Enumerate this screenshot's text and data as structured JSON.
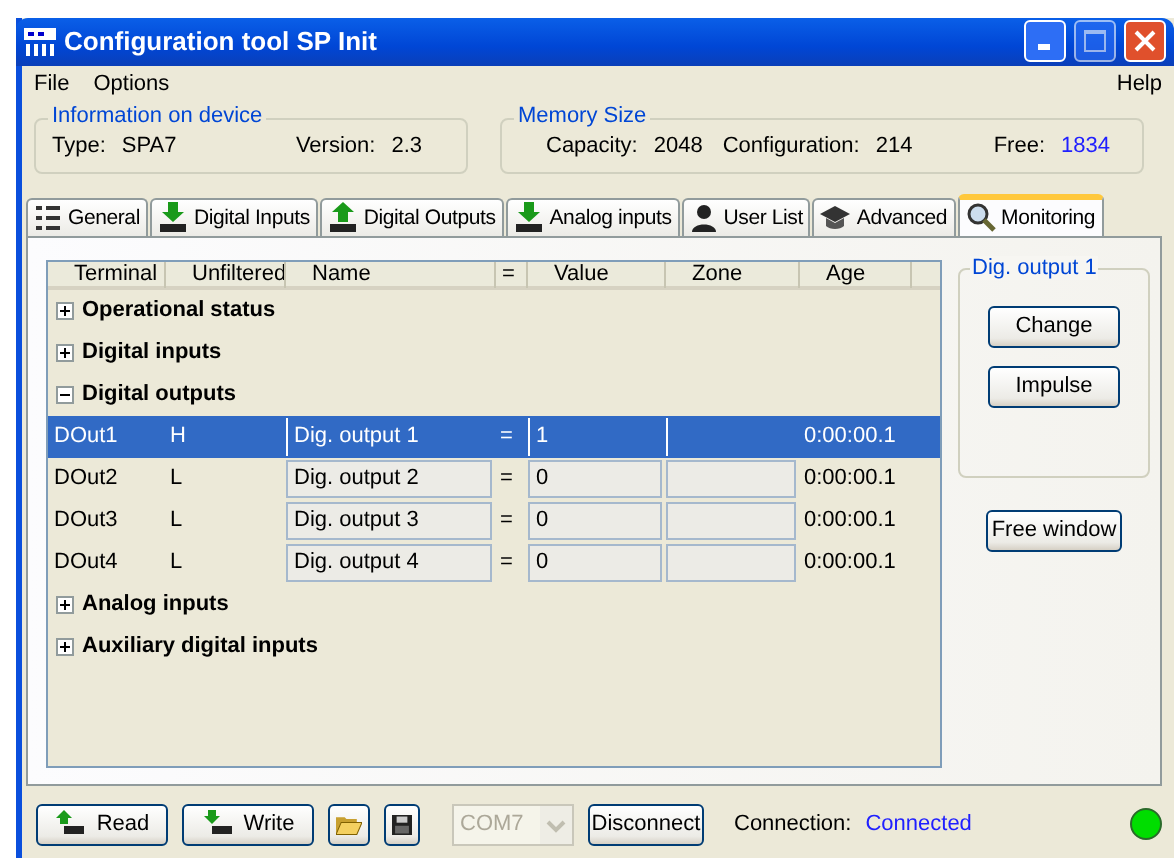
{
  "window": {
    "title": "Configuration tool SP Init"
  },
  "menu": [
    {
      "label": "File"
    },
    {
      "label": "Options"
    },
    {
      "label": "Help"
    }
  ],
  "device_info": {
    "title": "Information on device",
    "type_label": "Type:",
    "type": "SPA7",
    "version_label": "Version:",
    "version": "2.3"
  },
  "memory": {
    "title": "Memory Size",
    "capacity_label": "Capacity:",
    "capacity": "2048",
    "configuration_label": "Configuration:",
    "configuration": "214",
    "free_label": "Free:",
    "free": "1834"
  },
  "tabs": [
    {
      "label": "General",
      "kind": "list",
      "selected": false
    },
    {
      "label": "Digital Inputs",
      "kind": "down",
      "selected": false
    },
    {
      "label": "Digital Outputs",
      "kind": "up",
      "selected": false
    },
    {
      "label": "Analog inputs",
      "kind": "down",
      "selected": false
    },
    {
      "label": "User List",
      "kind": "person",
      "selected": false
    },
    {
      "label": "Advanced",
      "kind": "cap",
      "selected": false
    },
    {
      "label": "Monitoring",
      "kind": "search",
      "selected": true
    }
  ],
  "table": {
    "columns": [
      "Terminal",
      "Unfiltered",
      "Name",
      "=",
      "Value",
      "Zone",
      "Age"
    ],
    "groups": [
      {
        "label": "Operational status",
        "expanded": false
      },
      {
        "label": "Digital inputs",
        "expanded": false
      },
      {
        "label": "Digital outputs",
        "expanded": true,
        "rows": [
          {
            "terminal": "DOut1",
            "unfiltered": "H",
            "name": "Dig. output 1",
            "eq": "=",
            "value": "1",
            "age": "0:00:00.1",
            "selected": true
          },
          {
            "terminal": "DOut2",
            "unfiltered": "L",
            "name": "Dig. output 2",
            "eq": "=",
            "value": "0",
            "age": "0:00:00.1",
            "selected": false
          },
          {
            "terminal": "DOut3",
            "unfiltered": "L",
            "name": "Dig. output 3",
            "eq": "=",
            "value": "0",
            "age": "0:00:00.1",
            "selected": false
          },
          {
            "terminal": "DOut4",
            "unfiltered": "L",
            "name": "Dig. output 4",
            "eq": "=",
            "value": "0",
            "age": "0:00:00.1",
            "selected": false
          }
        ]
      },
      {
        "label": "Analog inputs",
        "expanded": false
      },
      {
        "label": "Auxiliary digital inputs",
        "expanded": false
      }
    ]
  },
  "side_panel": {
    "title": "Dig. output 1",
    "buttons": [
      "Change",
      "Impulse"
    ],
    "free_window": "Free window"
  },
  "bottom_bar": {
    "read": "Read",
    "write": "Write",
    "port": {
      "value": "COM7",
      "disabled": true
    },
    "disconnect": "Disconnect",
    "connection_label": "Connection:",
    "connection_status": "Connected",
    "online": true
  }
}
